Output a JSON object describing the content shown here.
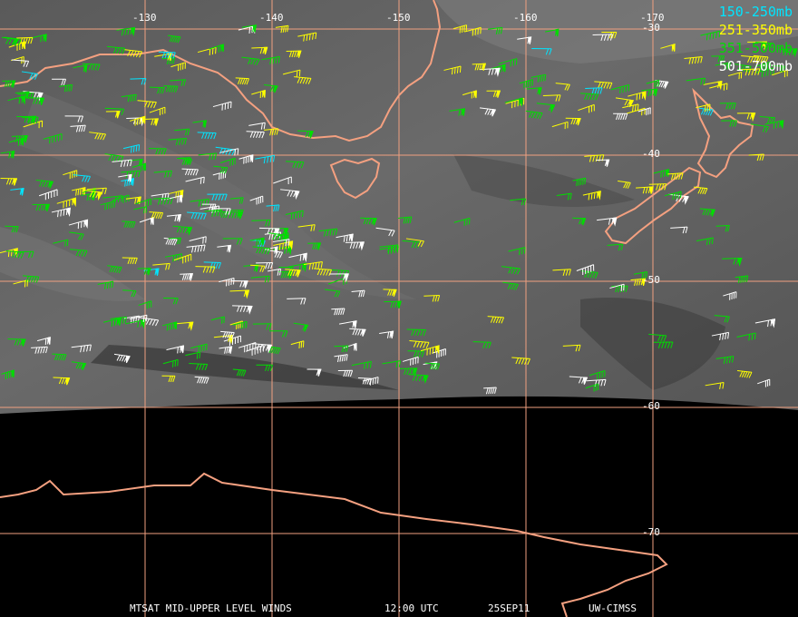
{
  "lon_labels": [
    {
      "lon": -130,
      "text": "-130"
    },
    {
      "lon": -140,
      "text": "-140"
    },
    {
      "lon": -150,
      "text": "-150"
    },
    {
      "lon": -160,
      "text": "-160"
    },
    {
      "lon": -170,
      "text": "-170"
    }
  ],
  "lat_labels": [
    {
      "lat": -30,
      "text": "-30"
    },
    {
      "lat": -40,
      "text": "-40"
    },
    {
      "lat": -50,
      "text": "-50"
    },
    {
      "lat": -60,
      "text": "-60"
    },
    {
      "lat": -70,
      "text": "-70"
    }
  ],
  "legend": [
    {
      "label": "150-250mb",
      "color": "#00e5ff"
    },
    {
      "label": "251-350mb",
      "color": "#ffff00"
    },
    {
      "label": "351-500mb",
      "color": "#00dd00"
    },
    {
      "label": "501-700mb",
      "color": "#ffffff"
    }
  ],
  "footer": {
    "product": "MTSAT MID-UPPER LEVEL WINDS",
    "time": "12:00 UTC",
    "date": "25SEP11",
    "source": "UW-CIMSS"
  },
  "colors": {
    "coast": "#f4a080",
    "grid": "#f0a080",
    "no_data": "#000000"
  }
}
